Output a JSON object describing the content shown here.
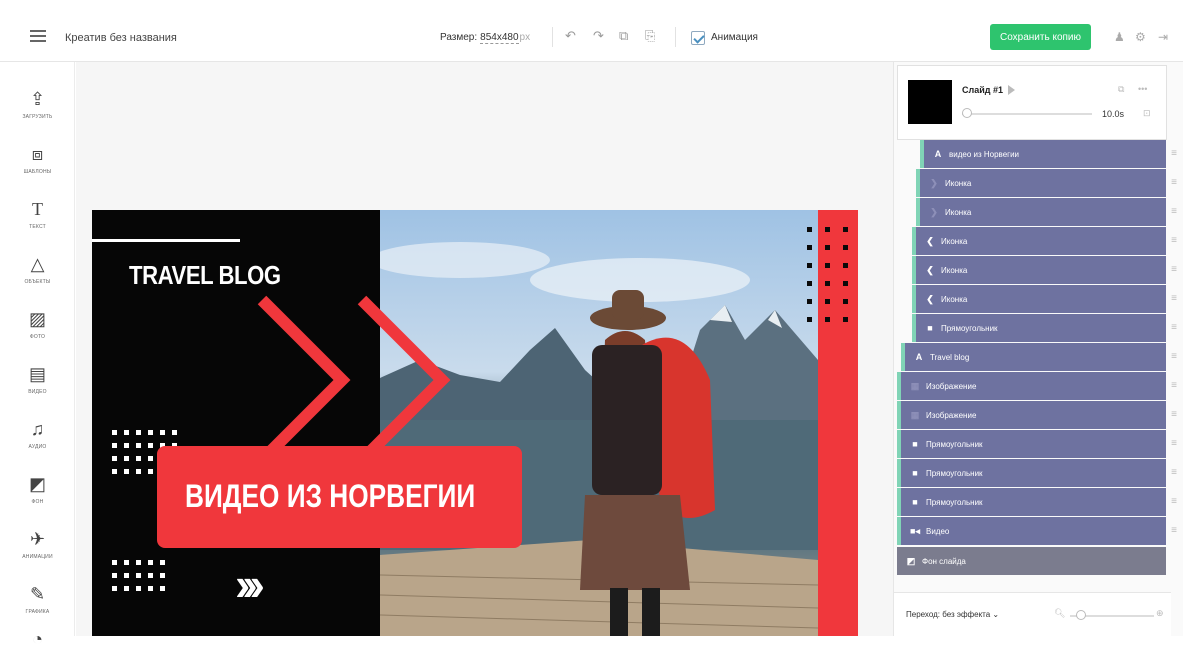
{
  "header": {
    "menu_icon": "hamburger-icon",
    "title": "Креатив без названия",
    "size_label": "Размер:",
    "size_value": "854x480",
    "size_unit": "px",
    "toolbar_icons": [
      "undo-icon",
      "redo-icon",
      "copy-icon",
      "paste-icon"
    ],
    "animation_label": "Анимация",
    "animation_checked": true,
    "save_label": "Сохранить копию",
    "right_icons": [
      "bell-icon",
      "gear-icon",
      "logout-icon"
    ],
    "accent": "#2ec46e"
  },
  "tools": [
    {
      "label": "ЗАГРУЗИТЬ",
      "icon": "upload-icon"
    },
    {
      "label": "ШАБЛОНЫ",
      "icon": "templates-icon"
    },
    {
      "label": "ТЕКСТ",
      "icon": "text-icon"
    },
    {
      "label": "ОБЪЕКТЫ",
      "icon": "objects-icon"
    },
    {
      "label": "ФОТО",
      "icon": "photo-icon"
    },
    {
      "label": "ВИДЕО",
      "icon": "video-icon"
    },
    {
      "label": "АУДИО",
      "icon": "audio-icon"
    },
    {
      "label": "ФОН",
      "icon": "background-icon"
    },
    {
      "label": "АНИМАЦИИ",
      "icon": "animations-icon"
    },
    {
      "label": "ГРАФИКА",
      "icon": "graphics-icon"
    }
  ],
  "canvas": {
    "heading": "TRAVEL BLOG",
    "banner": "ВИДЕО ИЗ НОРВЕГИИ",
    "arrows": "›››",
    "brand_red": "#f0373c"
  },
  "slide": {
    "name": "Слайд #1",
    "duration": "10.0s"
  },
  "layers": [
    {
      "label": "видео из Норвегии",
      "icon": "text-icon"
    },
    {
      "label": "Иконка",
      "icon": "chevron-right-icon"
    },
    {
      "label": "Иконка",
      "icon": "chevron-right-icon"
    },
    {
      "label": "Иконка",
      "icon": "chevron-left-icon"
    },
    {
      "label": "Иконка",
      "icon": "chevron-left-icon"
    },
    {
      "label": "Иконка",
      "icon": "chevron-left-icon"
    },
    {
      "label": "Прямоугольник",
      "icon": "rectangle-icon"
    },
    {
      "label": "Travel blog",
      "icon": "text-icon"
    },
    {
      "label": "Изображение",
      "icon": "image-grid-icon"
    },
    {
      "label": "Изображение",
      "icon": "image-grid-icon"
    },
    {
      "label": "Прямоугольник",
      "icon": "rectangle-icon"
    },
    {
      "label": "Прямоугольник",
      "icon": "rectangle-icon"
    },
    {
      "label": "Прямоугольник",
      "icon": "rectangle-icon"
    },
    {
      "label": "Видео",
      "icon": "video-icon"
    },
    {
      "label": "Фон слайда",
      "icon": "background-icon"
    }
  ],
  "transition": {
    "label": "Переход: без эффекта"
  }
}
